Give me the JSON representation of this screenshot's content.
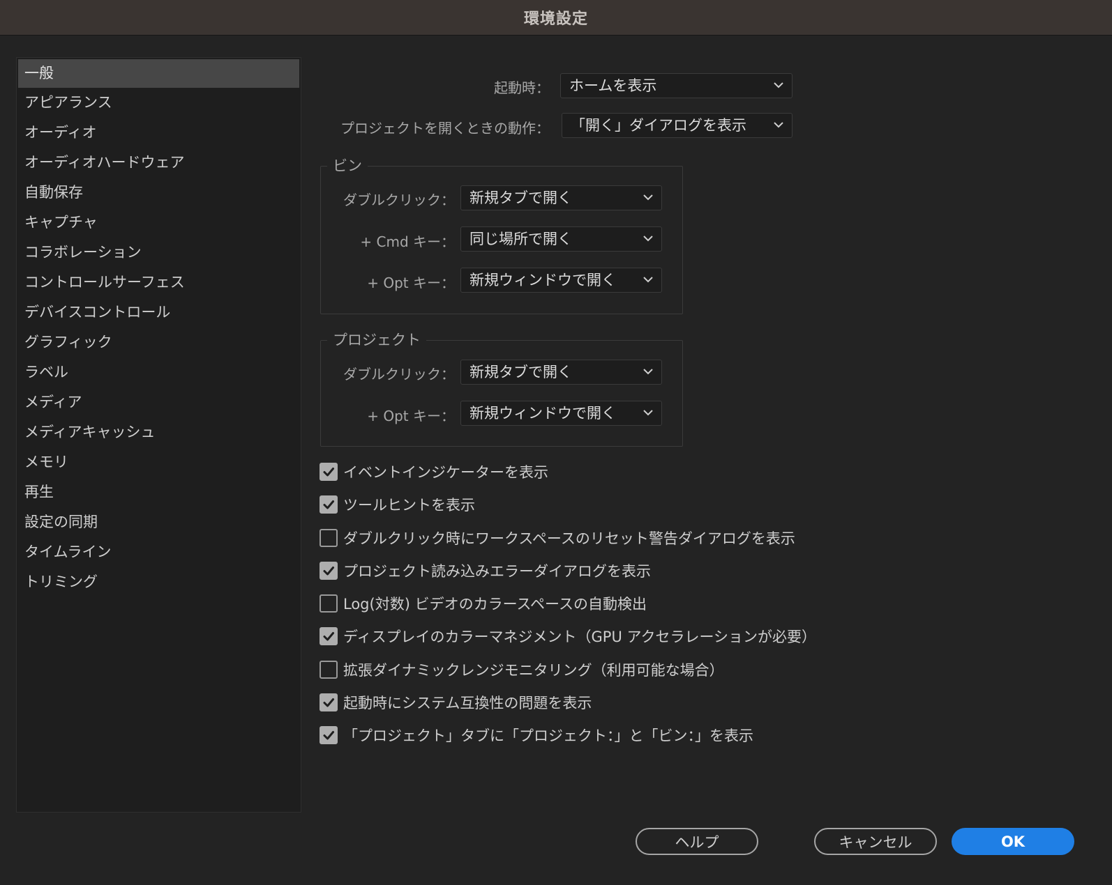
{
  "window": {
    "title": "環境設定"
  },
  "sidebar": {
    "items": [
      {
        "label": "一般",
        "selected": true
      },
      {
        "label": "アピアランス"
      },
      {
        "label": "オーディオ"
      },
      {
        "label": "オーディオハードウェア"
      },
      {
        "label": "自動保存"
      },
      {
        "label": "キャプチャ"
      },
      {
        "label": "コラボレーション"
      },
      {
        "label": "コントロールサーフェス"
      },
      {
        "label": "デバイスコントロール"
      },
      {
        "label": "グラフィック"
      },
      {
        "label": "ラベル"
      },
      {
        "label": "メディア"
      },
      {
        "label": "メディアキャッシュ"
      },
      {
        "label": "メモリ"
      },
      {
        "label": "再生"
      },
      {
        "label": "設定の同期"
      },
      {
        "label": "タイムライン"
      },
      {
        "label": "トリミング"
      }
    ]
  },
  "general": {
    "startup_label": "起動時：",
    "startup_value": "ホームを表示",
    "open_project_label": "プロジェクトを開くときの動作：",
    "open_project_value": "「開く」ダイアログを表示"
  },
  "bins": {
    "title": "ビン",
    "double_click_label": "ダブルクリック：",
    "double_click_value": "新規タブで開く",
    "cmd_label": "+ Cmd キー：",
    "cmd_value": "同じ場所で開く",
    "opt_label": "+ Opt キー：",
    "opt_value": "新規ウィンドウで開く"
  },
  "project": {
    "title": "プロジェクト",
    "double_click_label": "ダブルクリック：",
    "double_click_value": "新規タブで開く",
    "opt_label": "+ Opt キー：",
    "opt_value": "新規ウィンドウで開く"
  },
  "checkboxes": [
    {
      "label": "イベントインジケーターを表示",
      "checked": true
    },
    {
      "label": "ツールヒントを表示",
      "checked": true
    },
    {
      "label": "ダブルクリック時にワークスペースのリセット警告ダイアログを表示",
      "checked": false
    },
    {
      "label": "プロジェクト読み込みエラーダイアログを表示",
      "checked": true
    },
    {
      "label": "Log(対数) ビデオのカラースペースの自動検出",
      "checked": false
    },
    {
      "label": "ディスプレイのカラーマネジメント（GPU アクセラレーションが必要）",
      "checked": true
    },
    {
      "label": " 拡張ダイナミックレンジモニタリング（利用可能な場合）",
      "checked": false
    },
    {
      "label": "起動時にシステム互換性の問題を表示",
      "checked": true
    },
    {
      "label": "「プロジェクト」タブに「プロジェクト：」と「ビン：」を表示",
      "checked": true
    }
  ],
  "buttons": {
    "help": "ヘルプ",
    "cancel": "キャンセル",
    "ok": "OK"
  },
  "colors": {
    "primary": "#1f7fe5",
    "background": "#232323",
    "titlebar": "#3a3431"
  }
}
